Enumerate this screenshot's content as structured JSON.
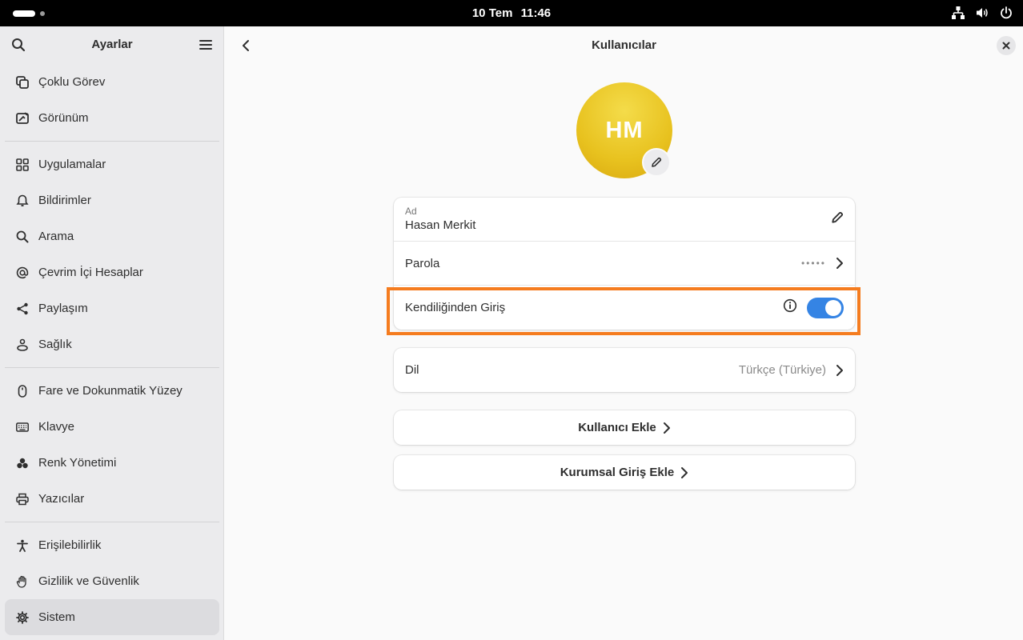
{
  "topbar": {
    "date": "10 Tem",
    "time": "11:46"
  },
  "sidebar": {
    "title": "Ayarlar",
    "items": [
      {
        "label": "Çoklu Görev"
      },
      {
        "label": "Görünüm"
      },
      {
        "label": "Uygulamalar"
      },
      {
        "label": "Bildirimler"
      },
      {
        "label": "Arama"
      },
      {
        "label": "Çevrim İçi Hesaplar"
      },
      {
        "label": "Paylaşım"
      },
      {
        "label": "Sağlık"
      },
      {
        "label": "Fare ve Dokunmatik Yüzey"
      },
      {
        "label": "Klavye"
      },
      {
        "label": "Renk Yönetimi"
      },
      {
        "label": "Yazıcılar"
      },
      {
        "label": "Erişilebilirlik"
      },
      {
        "label": "Gizlilik ve Güvenlik"
      },
      {
        "label": "Sistem"
      }
    ]
  },
  "main": {
    "title": "Kullanıcılar",
    "avatar_initials": "HM",
    "name_row": {
      "label": "Ad",
      "value": "Hasan Merkit"
    },
    "password_row": {
      "label": "Parola",
      "value": "•••••"
    },
    "autologin_row": {
      "label": "Kendiliğinden Giriş",
      "enabled": true
    },
    "language_row": {
      "label": "Dil",
      "value": "Türkçe (Türkiye)"
    },
    "add_user_label": "Kullanıcı Ekle",
    "add_enterprise_label": "Kurumsal Giriş Ekle"
  },
  "colors": {
    "accent": "#3584e4",
    "highlight": "#f57c1f",
    "avatar": "#e8c21f"
  }
}
